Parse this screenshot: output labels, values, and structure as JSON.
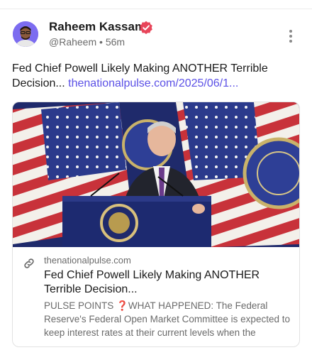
{
  "author": {
    "name": "Raheem Kassam",
    "handle": "@Raheem",
    "separator": "•",
    "time": "56m"
  },
  "post": {
    "text": "Fed Chief Powell Likely Making ANOTHER Terrible Decision...",
    "link_text": "thenationalpulse.com/2025/06/1..."
  },
  "card": {
    "domain": "thenationalpulse.com",
    "title": "Fed Chief Powell Likely Making ANOTHER Terrible Decision...",
    "description": "PULSE POINTS ❓WHAT HAPPENED: The Federal Reserve's Federal Open Market Committee is expected to keep interest rates at their current levels when the"
  },
  "icons": {
    "verified": "verified-badge-icon",
    "more": "more-options-icon",
    "link": "link-icon"
  },
  "colors": {
    "link": "#5b50e6",
    "verified": "#e8455a"
  }
}
